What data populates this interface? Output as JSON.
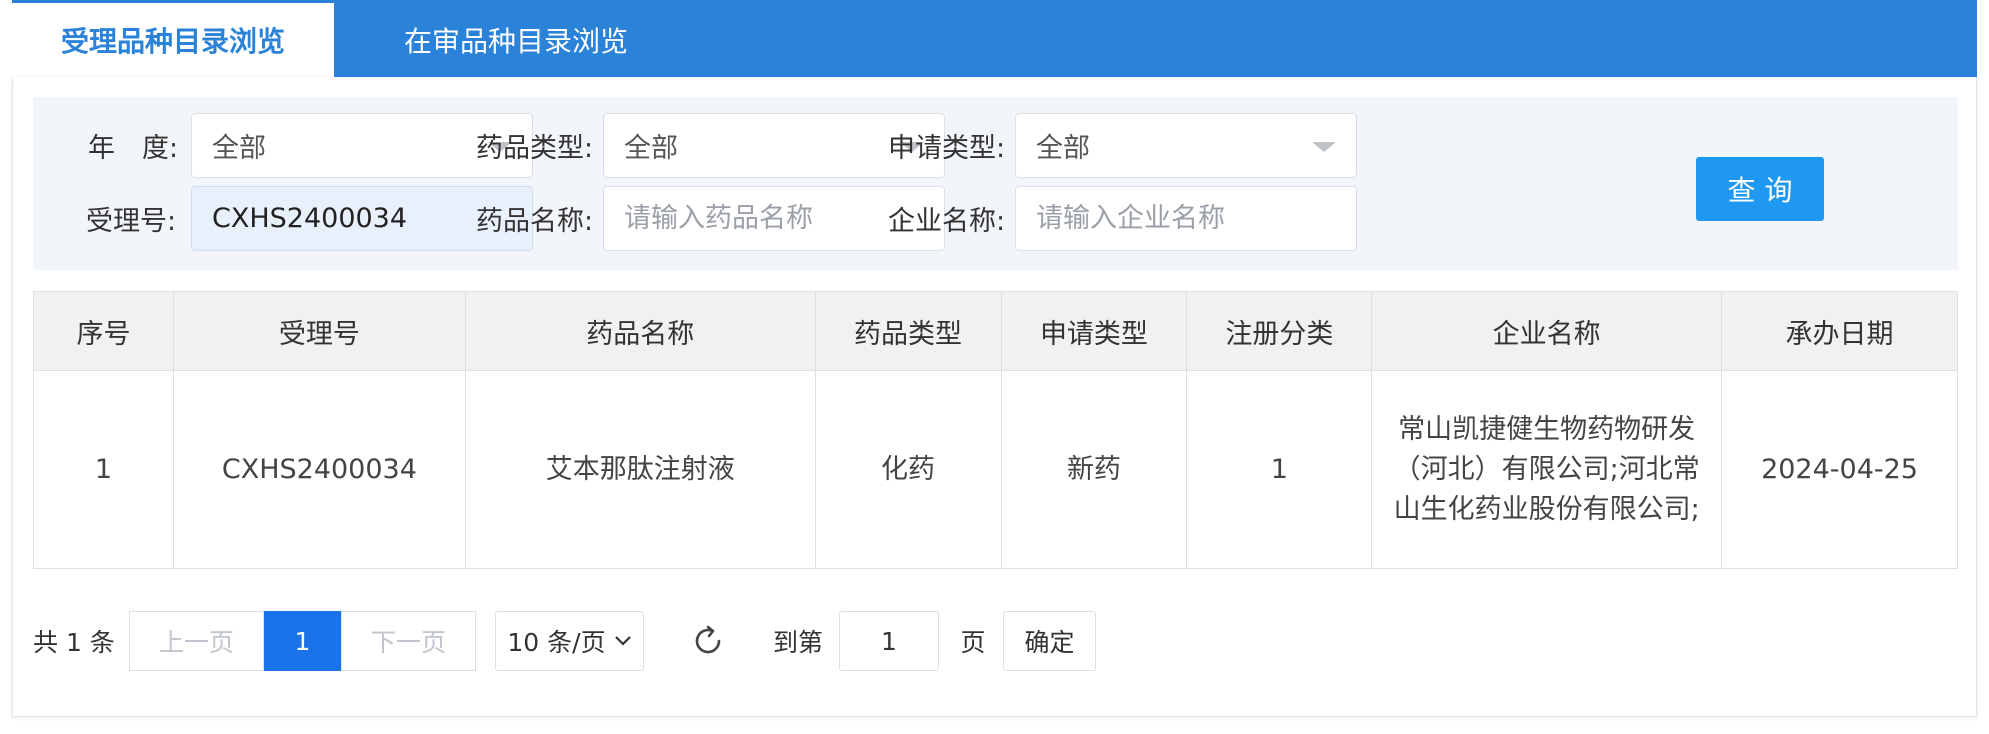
{
  "tabs": [
    {
      "label": "受理品种目录浏览",
      "active": true
    },
    {
      "label": "在审品种目录浏览",
      "active": false
    }
  ],
  "filters": {
    "year": {
      "label": "年　度:",
      "value": "全部"
    },
    "drug_type": {
      "label": "药品类型:",
      "value": "全部"
    },
    "apply_type": {
      "label": "申请类型:",
      "value": "全部"
    },
    "accept_no": {
      "label": "受理号:",
      "value": "CXHS2400034"
    },
    "drug_name": {
      "label": "药品名称:",
      "placeholder": "请输入药品名称"
    },
    "company": {
      "label": "企业名称:",
      "placeholder": "请输入企业名称"
    },
    "query_label": "查 询"
  },
  "table": {
    "headers": [
      "序号",
      "受理号",
      "药品名称",
      "药品类型",
      "申请类型",
      "注册分类",
      "企业名称",
      "承办日期"
    ],
    "rows": [
      {
        "index": "1",
        "accept_no": "CXHS2400034",
        "drug_name": "艾本那肽注射液",
        "drug_type": "化药",
        "apply_type": "新药",
        "reg_class": "1",
        "company": "常山凯捷健生物药物研发（河北）有限公司;河北常山生化药业股份有限公司;",
        "date": "2024-04-25"
      }
    ]
  },
  "pagination": {
    "total": "共 1 条",
    "prev": "上一页",
    "current": "1",
    "next": "下一页",
    "page_size": "10 条/页",
    "refresh_icon": "refresh-icon",
    "goto_prefix": "到第",
    "goto_value": "1",
    "goto_suffix": "页",
    "confirm": "确定"
  },
  "colors": {
    "tab_bar": "#2b82d9",
    "query_button": "#1e98f0",
    "current_page": "#1a73e8"
  }
}
